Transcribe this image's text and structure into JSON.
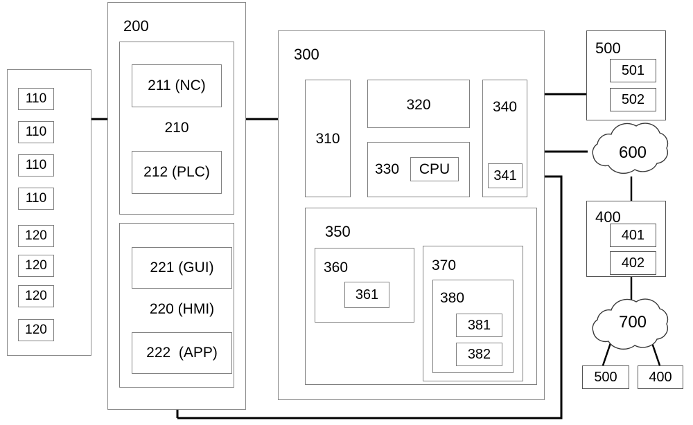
{
  "diagram": {
    "type": "patent-block-diagram",
    "background": "#ffffff",
    "line_color": "#000000",
    "box_border_color": "#808080"
  },
  "left_panel": {
    "name": "field-device-panel",
    "devices": [
      {
        "label": "110"
      },
      {
        "label": "110"
      },
      {
        "label": "110"
      },
      {
        "label": "110"
      },
      {
        "label": "120"
      },
      {
        "label": "120"
      },
      {
        "label": "120"
      },
      {
        "label": "120"
      }
    ]
  },
  "block_200": {
    "label": "200",
    "group_210": {
      "label": "210",
      "children": [
        {
          "label": "211 (NC)"
        },
        {
          "label": "212 (PLC)"
        }
      ]
    },
    "group_220": {
      "label": "220 (HMI)",
      "children": [
        {
          "label": "221 (GUI)"
        },
        {
          "label": "222  (APP)"
        }
      ]
    }
  },
  "block_300": {
    "label": "300",
    "unit_310": {
      "label": "310"
    },
    "unit_320": {
      "label": "320"
    },
    "unit_330": {
      "label": "330",
      "cpu": {
        "label": "CPU"
      }
    },
    "unit_340": {
      "label": "340",
      "sub_341": {
        "label": "341"
      }
    },
    "group_350": {
      "label": "350",
      "unit_360": {
        "label": "360",
        "sub_361": {
          "label": "361"
        }
      },
      "unit_370": {
        "label": "370",
        "group_380": {
          "label": "380",
          "children": [
            {
              "label": "381"
            },
            {
              "label": "382"
            }
          ]
        }
      }
    }
  },
  "block_500": {
    "label": "500",
    "children": [
      {
        "label": "501"
      },
      {
        "label": "502"
      }
    ]
  },
  "block_400": {
    "label": "400",
    "children": [
      {
        "label": "401"
      },
      {
        "label": "402"
      }
    ]
  },
  "cloud_600": {
    "label": "600"
  },
  "cloud_700": {
    "label": "700"
  },
  "cloud_700_clients": [
    {
      "label": "500"
    },
    {
      "label": "400"
    }
  ]
}
